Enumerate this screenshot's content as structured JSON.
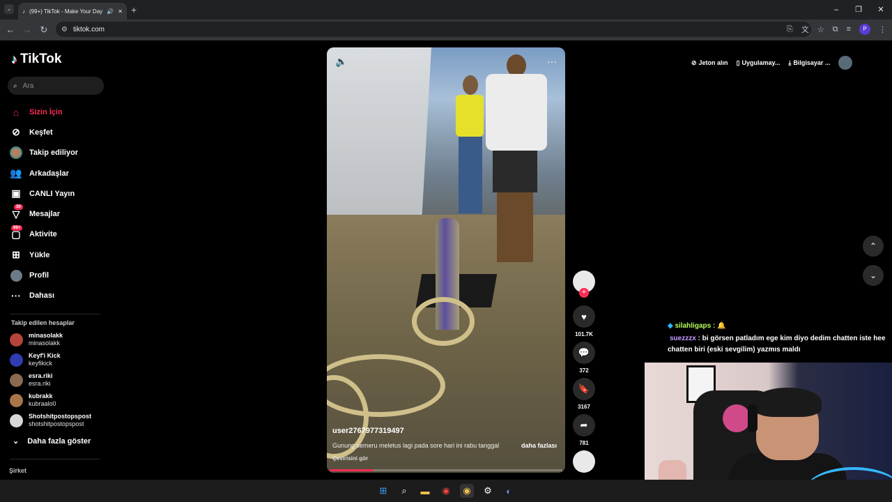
{
  "browser": {
    "tab_title": "(99+) TikTok - Make Your Day",
    "url": "tiktok.com",
    "profile_initial": "P"
  },
  "sidebar": {
    "logo": "TikTok",
    "search_placeholder": "Ara",
    "nav": [
      {
        "label": "Sizin İçin",
        "icon": "home-icon",
        "active": true
      },
      {
        "label": "Keşfet",
        "icon": "compass-icon"
      },
      {
        "label": "Takip ediliyor",
        "icon": "following-avatar-icon"
      },
      {
        "label": "Arkadaşlar",
        "icon": "friends-icon"
      },
      {
        "label": "CANLI Yayın",
        "icon": "live-icon"
      },
      {
        "label": "Mesajlar",
        "icon": "messages-icon",
        "badge": "30"
      },
      {
        "label": "Aktivite",
        "icon": "activity-icon",
        "badge": "99+"
      },
      {
        "label": "Yükle",
        "icon": "upload-icon"
      },
      {
        "label": "Profil",
        "icon": "profile-icon"
      },
      {
        "label": "Dahası",
        "icon": "more-icon"
      }
    ],
    "following_title": "Takip edilen hesaplar",
    "accounts": [
      {
        "name": "minasolakk",
        "handle": "minasolakk",
        "color": "#b5453a"
      },
      {
        "name": "Keyf'i Kick",
        "handle": "keyfikick",
        "color": "#2f3db0"
      },
      {
        "name": "esra.riki",
        "handle": "esra.riki",
        "color": "#8a6a50"
      },
      {
        "name": "kubrakk",
        "handle": "kubraalo0",
        "color": "#a9764a"
      },
      {
        "name": "Shotshitpostopspost",
        "handle": "shotshitpostopspost",
        "color": "#d7d7d7"
      }
    ],
    "show_more": "Daha fazla göster",
    "company": "Şirket"
  },
  "video": {
    "username": "user2767977319497",
    "description": "Gunung semeru meletus lagi pada sore hari ini rabu tanggal",
    "more": "daha fazlası",
    "translate": "Çevirisini gör",
    "progress": 0.19
  },
  "actions": {
    "likes": "101.7K",
    "comments": "372",
    "saves": "3167",
    "shares": "781"
  },
  "topbar": {
    "coins": "Jeton alın",
    "app": "Uygulamay...",
    "desktop": "Bilgisayar ..."
  },
  "stream_chat": {
    "line1_user": "silahligaps :",
    "line1_msg": "🔔",
    "line2_user": "suezzzx",
    "line2_msg": ": bi görsen patladım ege kim diyo dedim chatten iste hee chatten biri (eski sevgilim) yazmıs maldı"
  }
}
